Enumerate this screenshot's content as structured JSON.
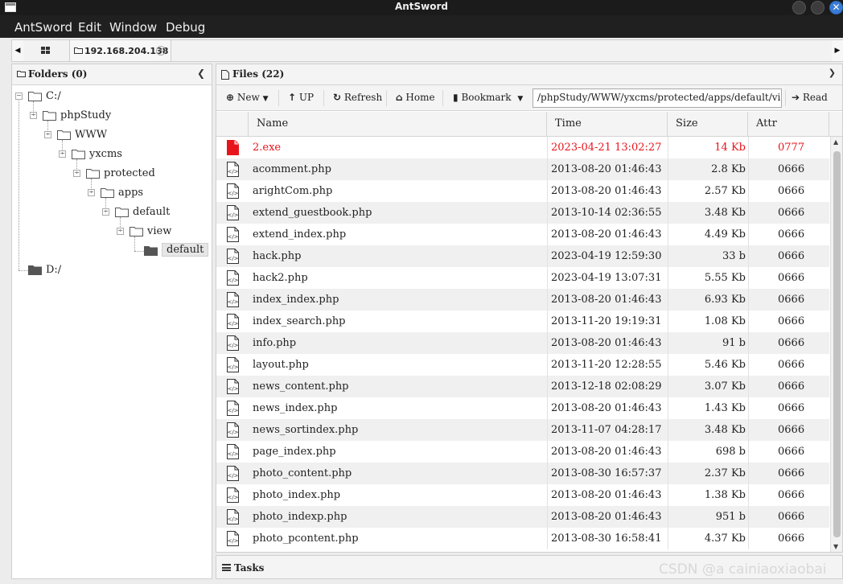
{
  "window": {
    "title": "AntSword"
  },
  "menubar": {
    "items": [
      "AntSword",
      "Edit",
      "Window",
      "Debug"
    ]
  },
  "tabs": {
    "host_tab": "192.168.204.138"
  },
  "folders": {
    "header": "Folders (0)",
    "tree": [
      {
        "label": "C:/",
        "level": 0
      },
      {
        "label": "phpStudy",
        "level": 1
      },
      {
        "label": "WWW",
        "level": 2
      },
      {
        "label": "yxcms",
        "level": 3
      },
      {
        "label": "protected",
        "level": 4
      },
      {
        "label": "apps",
        "level": 5
      },
      {
        "label": "default",
        "level": 6
      },
      {
        "label": "view",
        "level": 7
      },
      {
        "label": "default",
        "level": 8,
        "selected": true
      },
      {
        "label": "D:/",
        "level": 0
      }
    ]
  },
  "files": {
    "header": "Files (22)",
    "toolbar": {
      "new": "New",
      "up": "UP",
      "refresh": "Refresh",
      "home": "Home",
      "bookmark": "Bookmark",
      "path": "/phpStudy/WWW/yxcms/protected/apps/default/view/default/",
      "read": "Read"
    },
    "columns": [
      "Name",
      "Time",
      "Size",
      "Attr"
    ],
    "rows": [
      {
        "name": "2.exe",
        "time": "2023-04-21 13:02:27",
        "size": "14 Kb",
        "attr": "0777",
        "highlight": true
      },
      {
        "name": "acomment.php",
        "time": "2013-08-20 01:46:43",
        "size": "2.8 Kb",
        "attr": "0666"
      },
      {
        "name": "arightCom.php",
        "time": "2013-08-20 01:46:43",
        "size": "2.57 Kb",
        "attr": "0666"
      },
      {
        "name": "extend_guestbook.php",
        "time": "2013-10-14 02:36:55",
        "size": "3.48 Kb",
        "attr": "0666"
      },
      {
        "name": "extend_index.php",
        "time": "2013-08-20 01:46:43",
        "size": "4.49 Kb",
        "attr": "0666"
      },
      {
        "name": "hack.php",
        "time": "2023-04-19 12:59:30",
        "size": "33 b",
        "attr": "0666"
      },
      {
        "name": "hack2.php",
        "time": "2023-04-19 13:07:31",
        "size": "5.55 Kb",
        "attr": "0666"
      },
      {
        "name": "index_index.php",
        "time": "2013-08-20 01:46:43",
        "size": "6.93 Kb",
        "attr": "0666"
      },
      {
        "name": "index_search.php",
        "time": "2013-11-20 19:19:31",
        "size": "1.08 Kb",
        "attr": "0666"
      },
      {
        "name": "info.php",
        "time": "2013-08-20 01:46:43",
        "size": "91 b",
        "attr": "0666"
      },
      {
        "name": "layout.php",
        "time": "2013-11-20 12:28:55",
        "size": "5.46 Kb",
        "attr": "0666"
      },
      {
        "name": "news_content.php",
        "time": "2013-12-18 02:08:29",
        "size": "3.07 Kb",
        "attr": "0666"
      },
      {
        "name": "news_index.php",
        "time": "2013-08-20 01:46:43",
        "size": "1.43 Kb",
        "attr": "0666"
      },
      {
        "name": "news_sortindex.php",
        "time": "2013-11-07 04:28:17",
        "size": "3.48 Kb",
        "attr": "0666"
      },
      {
        "name": "page_index.php",
        "time": "2013-08-20 01:46:43",
        "size": "698 b",
        "attr": "0666"
      },
      {
        "name": "photo_content.php",
        "time": "2013-08-30 16:57:37",
        "size": "2.37 Kb",
        "attr": "0666"
      },
      {
        "name": "photo_index.php",
        "time": "2013-08-20 01:46:43",
        "size": "1.38 Kb",
        "attr": "0666"
      },
      {
        "name": "photo_indexp.php",
        "time": "2013-08-20 01:46:43",
        "size": "951 b",
        "attr": "0666"
      },
      {
        "name": "photo_pcontent.php",
        "time": "2013-08-30 16:58:41",
        "size": "4.37 Kb",
        "attr": "0666"
      }
    ]
  },
  "tasks": {
    "header": "Tasks"
  },
  "watermark": "CSDN @a cainiaoxiaobai",
  "colors": {
    "highlight": "#e8141b",
    "titlebar": "#1b1b1b",
    "menubar": "#202020",
    "accent": "#3a7bd5"
  }
}
